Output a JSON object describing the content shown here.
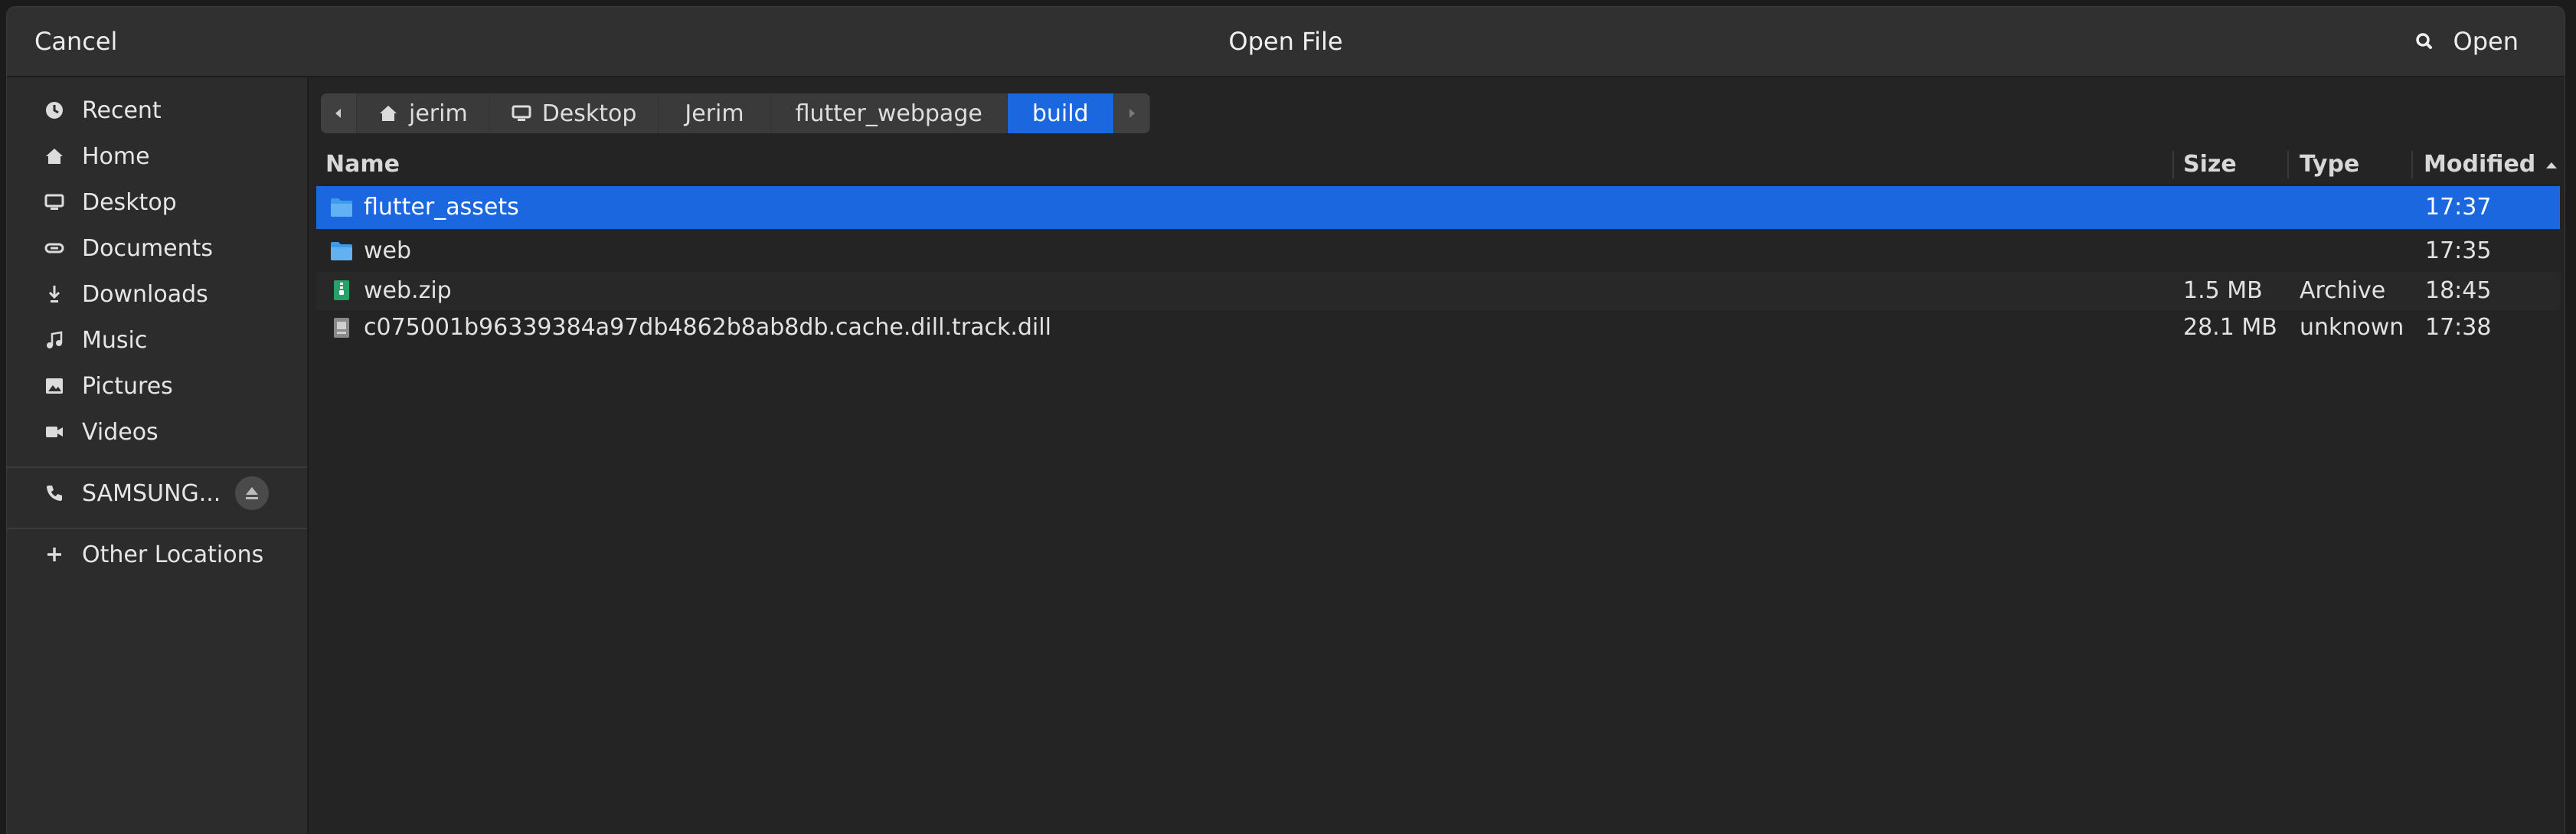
{
  "titlebar": {
    "cancel_label": "Cancel",
    "title": "Open File",
    "open_label": "Open",
    "search_icon": "search-icon"
  },
  "sidebar": {
    "items": [
      {
        "label": "Recent",
        "icon": "clock-icon"
      },
      {
        "label": "Home",
        "icon": "home-icon"
      },
      {
        "label": "Desktop",
        "icon": "desktop-icon"
      },
      {
        "label": "Documents",
        "icon": "documents-icon"
      },
      {
        "label": "Downloads",
        "icon": "download-icon"
      },
      {
        "label": "Music",
        "icon": "music-icon"
      },
      {
        "label": "Pictures",
        "icon": "picture-icon"
      },
      {
        "label": "Videos",
        "icon": "video-icon"
      }
    ],
    "device": {
      "label": "SAMSUNG...",
      "icon": "phone-icon",
      "eject_icon": "eject-icon"
    },
    "other_locations": {
      "label": "Other Locations",
      "icon": "plus-icon"
    }
  },
  "pathbar": {
    "segments": [
      "jerim",
      "Desktop",
      "Jerim",
      "flutter_webpage",
      "build"
    ],
    "active_index": 4
  },
  "columns": {
    "name": "Name",
    "size": "Size",
    "type": "Type",
    "modified": "Modified"
  },
  "files": [
    {
      "name": "flutter_assets",
      "size": "",
      "type": "",
      "modified": "17:37",
      "kind": "folder",
      "selected": true
    },
    {
      "name": "web",
      "size": "",
      "type": "",
      "modified": "17:35",
      "kind": "folder",
      "selected": false
    },
    {
      "name": "web.zip",
      "size": "1.5 MB",
      "type": "Archive",
      "modified": "18:45",
      "kind": "archive",
      "selected": false
    },
    {
      "name": "c075001b96339384a97db4862b8ab8db.cache.dill.track.dill",
      "size": "28.1 MB",
      "type": "unknown",
      "modified": "17:38",
      "kind": "unknown",
      "selected": false
    }
  ],
  "colors": {
    "accent": "#1a67e0",
    "folder": "#3d9be9",
    "archive": "#26a269"
  }
}
